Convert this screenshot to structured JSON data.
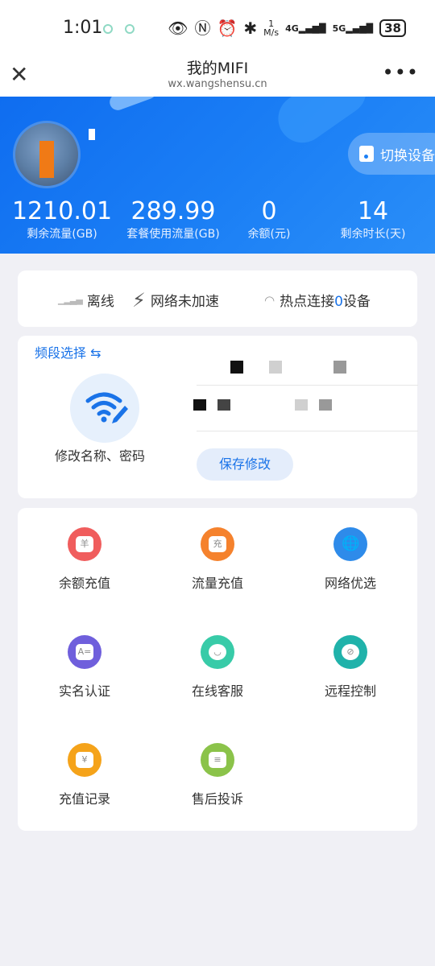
{
  "status_bar": {
    "time": "1:01",
    "net_speed_top": "1",
    "net_speed_unit": "M/s",
    "sim1": "4G",
    "sim2": "5G",
    "battery": "38"
  },
  "nav": {
    "title": "我的MIFI",
    "subtitle": "wx.wangshensu.cn",
    "close_icon": "✕",
    "more_icon": "•••"
  },
  "hero": {
    "switch_label": "切换设备",
    "stats": [
      {
        "value": "1210.01",
        "label": "剩余流量(GB)"
      },
      {
        "value": "289.99",
        "label": "套餐使用流量(GB)"
      },
      {
        "value": "0",
        "label": "余额(元)"
      },
      {
        "value": "14",
        "label": "剩余时长(天)"
      }
    ]
  },
  "status_row": {
    "offline": "离线",
    "not_accelerated": "网络未加速",
    "hotspot_prefix": "热点连接",
    "hotspot_count": "0",
    "hotspot_suffix": "设备"
  },
  "band": {
    "title": "频段选择 ⇆",
    "edit_label": "修改名称、密码",
    "save_label": "保存修改"
  },
  "services": [
    {
      "label": "余额充值",
      "color": "#f05d5d",
      "glyph": "羊"
    },
    {
      "label": "流量充值",
      "color": "#f5822d",
      "glyph": "充"
    },
    {
      "label": "网络优选",
      "color": "#2e8bea",
      "glyph": "🌐"
    },
    {
      "label": "实名认证",
      "color": "#6f5fdc",
      "glyph": "A="
    },
    {
      "label": "在线客服",
      "color": "#38cba8",
      "glyph": "◡"
    },
    {
      "label": "远程控制",
      "color": "#20b2aa",
      "glyph": "⊘"
    },
    {
      "label": "充值记录",
      "color": "#f5a31a",
      "glyph": "¥"
    },
    {
      "label": "售后投诉",
      "color": "#8bc34a",
      "glyph": "≡"
    }
  ]
}
